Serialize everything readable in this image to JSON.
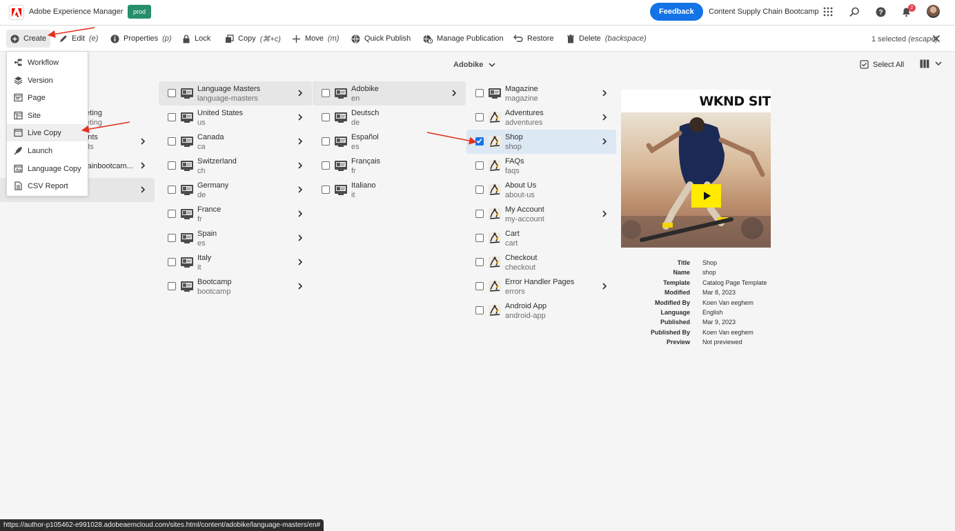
{
  "header": {
    "app_title": "Adobe Experience Manager",
    "env_badge": "prod",
    "feedback_label": "Feedback",
    "org_name": "Content Supply Chain Bootcamp",
    "notification_count": "2",
    "icons": [
      "apps-grid-icon",
      "search-icon",
      "help-icon",
      "bell-icon"
    ]
  },
  "actions": {
    "create": "Create",
    "edit": "Edit",
    "edit_key": "(e)",
    "properties": "Properties",
    "properties_key": "(p)",
    "lock": "Lock",
    "copy": "Copy",
    "copy_key": "(⌘+c)",
    "move": "Move",
    "move_key": "(m)",
    "quick_publish": "Quick Publish",
    "manage_publication": "Manage Publication",
    "restore": "Restore",
    "delete": "Delete",
    "delete_key": "(backspace)",
    "selected_count": "1 selected",
    "selected_key": "(escape)"
  },
  "columnbar": {
    "breadcrumb": "Adobike",
    "select_all": "Select All"
  },
  "create_menu": {
    "items": [
      {
        "label": "Workflow",
        "icon": "workflow-icon"
      },
      {
        "label": "Version",
        "icon": "layers-icon"
      },
      {
        "label": "Page",
        "icon": "page-icon"
      },
      {
        "label": "Site",
        "icon": "site-icon"
      },
      {
        "label": "Live Copy",
        "icon": "live-copy-icon"
      },
      {
        "label": "Launch",
        "icon": "launch-icon"
      },
      {
        "label": "Language Copy",
        "icon": "language-copy-icon"
      },
      {
        "label": "CSV Report",
        "icon": "csv-report-icon"
      }
    ]
  },
  "column1": {
    "rows": [
      {
        "title": "rketing",
        "sub": "rketing"
      },
      {
        "title": "nents",
        "sub": "ents"
      },
      {
        "title": "chainbootcam...",
        "sub": ""
      },
      {
        "title": "",
        "sub": ""
      }
    ]
  },
  "column2": {
    "rows": [
      {
        "title": "Language Masters",
        "sub": "language-masters"
      },
      {
        "title": "United States",
        "sub": "us"
      },
      {
        "title": "Canada",
        "sub": "ca"
      },
      {
        "title": "Switzerland",
        "sub": "ch"
      },
      {
        "title": "Germany",
        "sub": "de"
      },
      {
        "title": "France",
        "sub": "fr"
      },
      {
        "title": "Spain",
        "sub": "es"
      },
      {
        "title": "Italy",
        "sub": "it"
      },
      {
        "title": "Bootcamp",
        "sub": "bootcamp"
      }
    ]
  },
  "column3": {
    "rows": [
      {
        "title": "Adobike",
        "sub": "en"
      },
      {
        "title": "Deutsch",
        "sub": "de"
      },
      {
        "title": "Español",
        "sub": "es"
      },
      {
        "title": "Français",
        "sub": "fr"
      },
      {
        "title": "Italiano",
        "sub": "it"
      }
    ]
  },
  "column4": {
    "rows": [
      {
        "title": "Magazine",
        "sub": "magazine"
      },
      {
        "title": "Adventures",
        "sub": "adventures"
      },
      {
        "title": "Shop",
        "sub": "shop"
      },
      {
        "title": "FAQs",
        "sub": "faqs"
      },
      {
        "title": "About Us",
        "sub": "about-us"
      },
      {
        "title": "My Account",
        "sub": "my-account"
      },
      {
        "title": "Cart",
        "sub": "cart"
      },
      {
        "title": "Checkout",
        "sub": "checkout"
      },
      {
        "title": "Error Handler Pages",
        "sub": "errors"
      },
      {
        "title": "Android App",
        "sub": "android-app"
      }
    ]
  },
  "preview": {
    "brand": "WKND SIT",
    "meta": [
      {
        "key": "Title",
        "value": "Shop"
      },
      {
        "key": "Name",
        "value": "shop"
      },
      {
        "key": "Template",
        "value": "Catalog Page Template"
      },
      {
        "key": "Modified",
        "value": "Mar 8, 2023"
      },
      {
        "key": "Modified By",
        "value": "Koen Van eeghem"
      },
      {
        "key": "Language",
        "value": "English"
      },
      {
        "key": "Published",
        "value": "Mar 9, 2023"
      },
      {
        "key": "Published By",
        "value": "Koen Van eeghem"
      },
      {
        "key": "Preview",
        "value": "Not previewed"
      }
    ]
  },
  "status_url": "https://author-p105462-e991028.adobeaemcloud.com/sites.html/content/adobike/language-masters/en#",
  "colors": {
    "accent": "#1473e6",
    "badge": "#268e6c",
    "adobe_red": "#eb1000",
    "annotation_arrow": "#e3321f"
  }
}
